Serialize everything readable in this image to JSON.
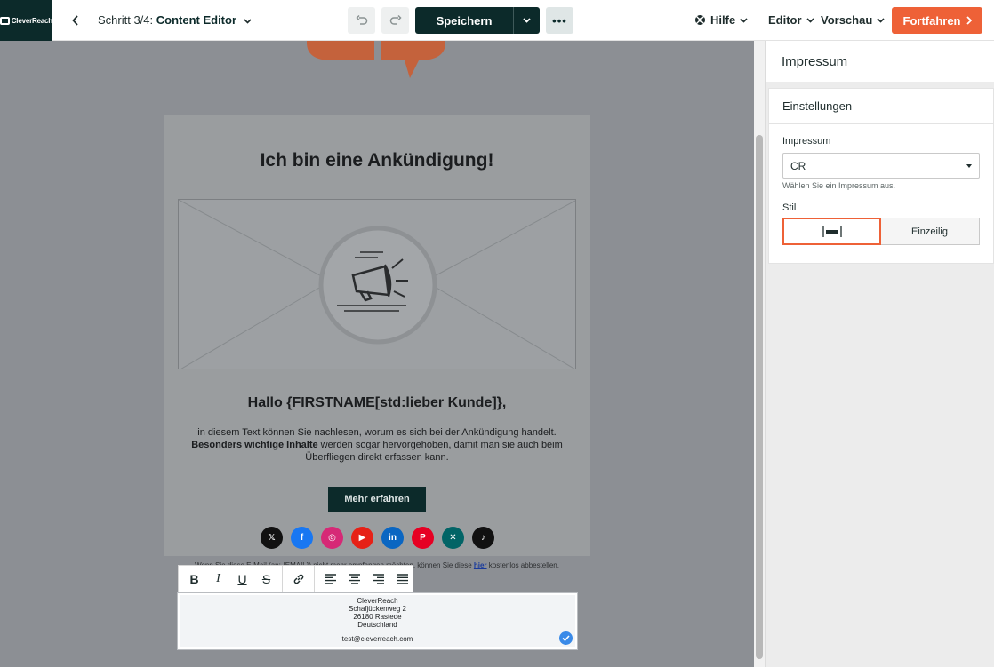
{
  "topbar": {
    "logo_text": "CleverReach",
    "step_prefix": "Schritt 3/4: ",
    "step_current": "Content Editor",
    "save_label": "Speichern",
    "more_label": "•••",
    "help_label": "Hilfe",
    "editor_label": "Editor",
    "preview_label": "Vorschau",
    "continue_label": "Fortfahren"
  },
  "email": {
    "headline": "Ich bin eine Ankündigung!",
    "greeting": "Hallo {FIRSTNAME[std:lieber Kunde]},",
    "body_line1": "in diesem Text können Sie nachlesen, worum es sich bei der Ankündigung handelt.",
    "body_bold": "Besonders wichtige Inhalte",
    "body_line2": " werden sogar hervorgehoben, damit man sie auch beim Überfliegen direkt erfassen kann.",
    "cta_label": "Mehr erfahren",
    "socials": [
      {
        "name": "x",
        "glyph": "𝕏",
        "color": "#111111"
      },
      {
        "name": "facebook",
        "glyph": "f",
        "color": "#1877f2"
      },
      {
        "name": "instagram",
        "glyph": "◎",
        "color": "#d62976"
      },
      {
        "name": "youtube",
        "glyph": "▶",
        "color": "#e62117"
      },
      {
        "name": "linkedin",
        "glyph": "in",
        "color": "#0a66c2"
      },
      {
        "name": "pinterest",
        "glyph": "P",
        "color": "#e60023"
      },
      {
        "name": "xing",
        "glyph": "✕",
        "color": "#026466"
      },
      {
        "name": "tiktok",
        "glyph": "♪",
        "color": "#111111"
      }
    ],
    "footer_prefix": "Wenn Sie diese E-Mail (an: {EMAIL}) nicht mehr empfangen möchten, können Sie diese ",
    "footer_link": "hier",
    "footer_suffix": " kostenlos abbestellen."
  },
  "imprint": {
    "lines": [
      "CleverReach",
      "Schafjückenweg 2",
      "26180 Rastede",
      "Deutschland"
    ],
    "email": "test@cleverreach.com"
  },
  "panel": {
    "title": "Impressum",
    "section_title": "Einstellungen",
    "select_label": "Impressum",
    "select_value": "CR",
    "select_hint": "Wählen Sie ein Impressum aus.",
    "style_label": "Stil",
    "style_option_single": "Einzeilig"
  },
  "colors": {
    "brand_dark": "#0c2a2a",
    "accent_orange": "#ee6137",
    "check_blue": "#3a8ae8"
  }
}
